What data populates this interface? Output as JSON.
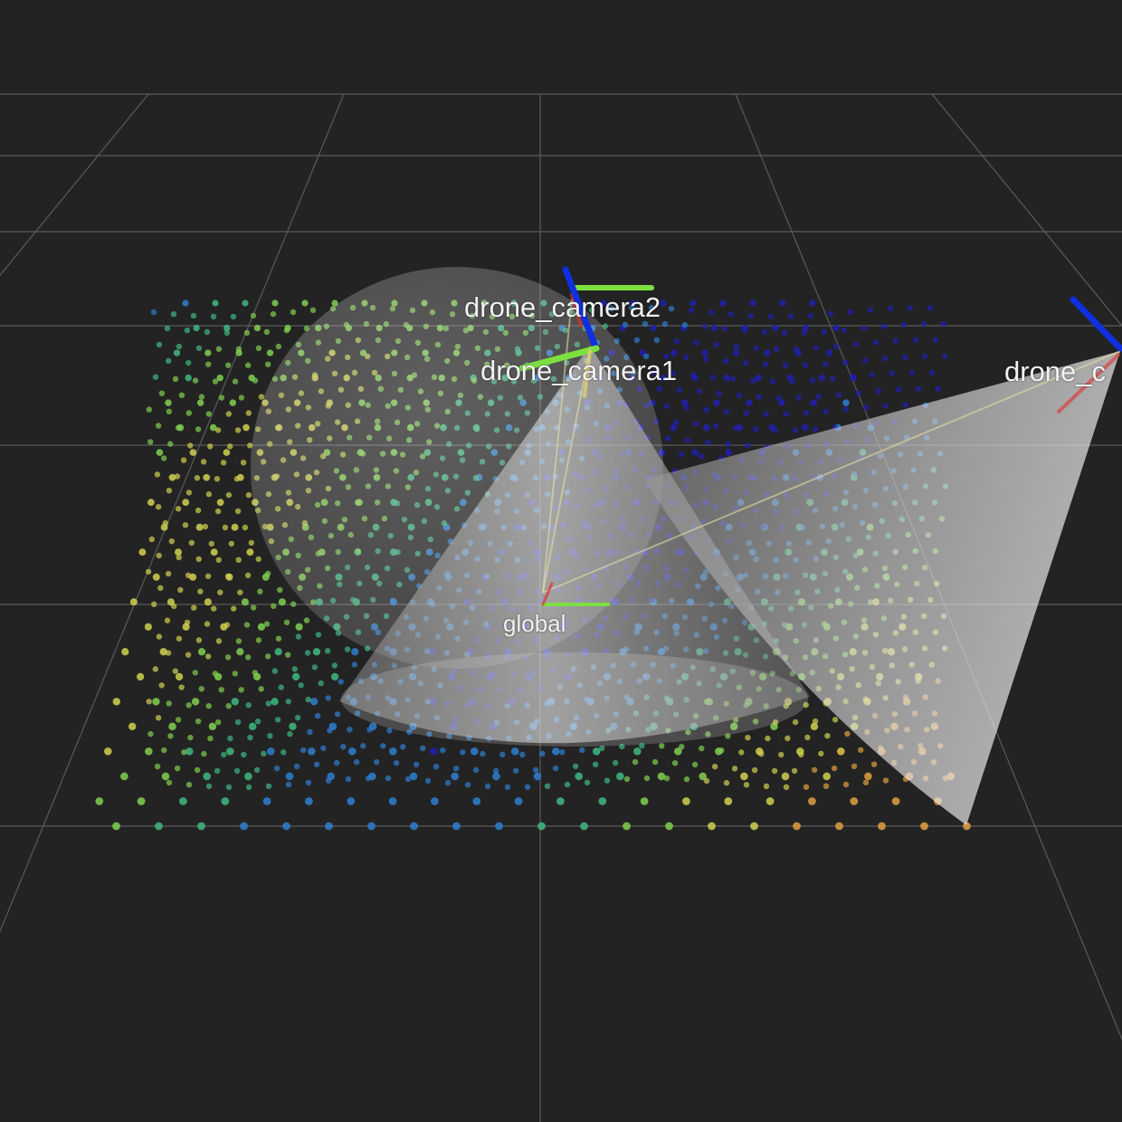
{
  "scene": {
    "background_color": "#232323",
    "grid_color": "#5a5a5a",
    "frames": [
      {
        "id": "drone_camera2",
        "label": "drone_camera2"
      },
      {
        "id": "drone_camera1",
        "label": "drone_camera1"
      },
      {
        "id": "drone_camera3",
        "label": "drone_c"
      },
      {
        "id": "global",
        "label": "global"
      }
    ],
    "axis_colors": {
      "x": "#e03030",
      "y": "#7ee040",
      "z": "#1030e0"
    },
    "cone_color": "#e6e6e6",
    "pointcloud_colormap": [
      "#2020b0",
      "#2e7fd0",
      "#40b880",
      "#80d050",
      "#d0d050",
      "#e0a040"
    ]
  }
}
